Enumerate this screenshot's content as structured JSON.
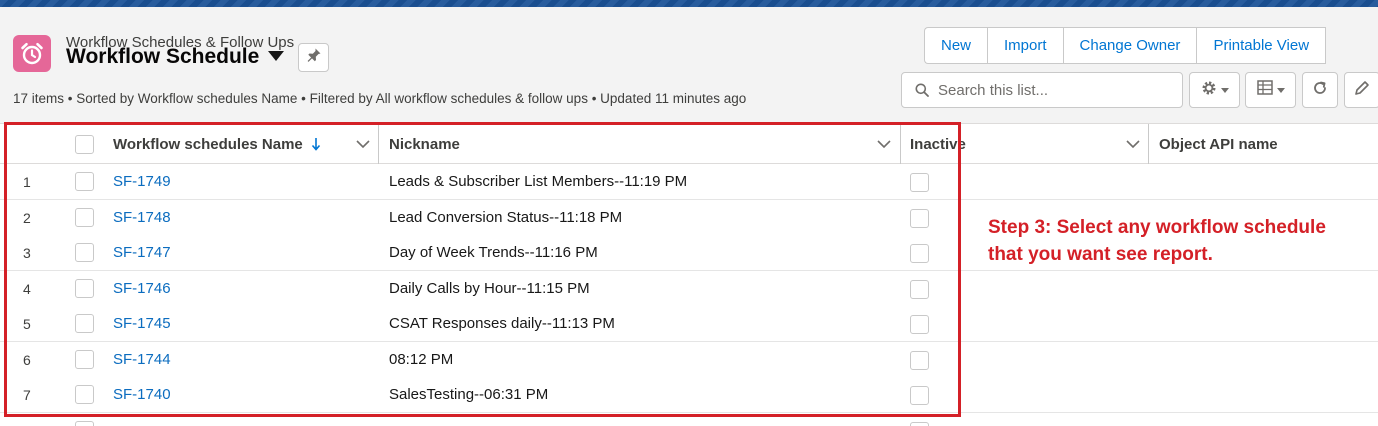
{
  "header": {
    "object_label": "Workflow Schedules & Follow Ups",
    "list_view_name": "Workflow Schedule",
    "icons": {
      "object": "alarm-clock-icon",
      "list_switcher": "caret-down-icon",
      "pin": "pin-icon"
    },
    "status": "17 items • Sorted by Workflow schedules Name • Filtered by All workflow schedules & follow ups • Updated 11 minutes ago"
  },
  "actions": [
    {
      "label": "New"
    },
    {
      "label": "Import"
    },
    {
      "label": "Change Owner"
    },
    {
      "label": "Printable View"
    }
  ],
  "search": {
    "placeholder": "Search this list..."
  },
  "toolbar_icons": [
    "gear-icon",
    "table-icon",
    "refresh-icon",
    "pencil-icon"
  ],
  "table": {
    "columns": [
      {
        "label": "Workflow schedules Name",
        "sort": "descending"
      },
      {
        "label": "Nickname"
      },
      {
        "label": "Inactive"
      },
      {
        "label": "Object API name"
      }
    ],
    "rows": [
      {
        "num": "1",
        "name": "SF-1749",
        "nickname": "Leads & Subscriber List Members--11:19 PM"
      },
      {
        "num": "2",
        "name": "SF-1748",
        "nickname": "Lead Conversion Status--11:18 PM"
      },
      {
        "num": "3",
        "name": "SF-1747",
        "nickname": "Day of Week Trends--11:16 PM"
      },
      {
        "num": "4",
        "name": "SF-1746",
        "nickname": "Daily Calls by Hour--11:15 PM"
      },
      {
        "num": "5",
        "name": "SF-1745",
        "nickname": "CSAT Responses daily--11:13 PM"
      },
      {
        "num": "6",
        "name": "SF-1744",
        "nickname": "08:12 PM"
      },
      {
        "num": "7",
        "name": "SF-1740",
        "nickname": "SalesTesting--06:31 PM"
      }
    ]
  },
  "annotation": {
    "text": "Step 3: Select any workflow schedule that you want see report.",
    "color": "#d42027"
  },
  "colors": {
    "brand": "#1b5297",
    "link": "#0b6cbf",
    "object_icon": "#e56798",
    "button_text": "#0176d3"
  }
}
